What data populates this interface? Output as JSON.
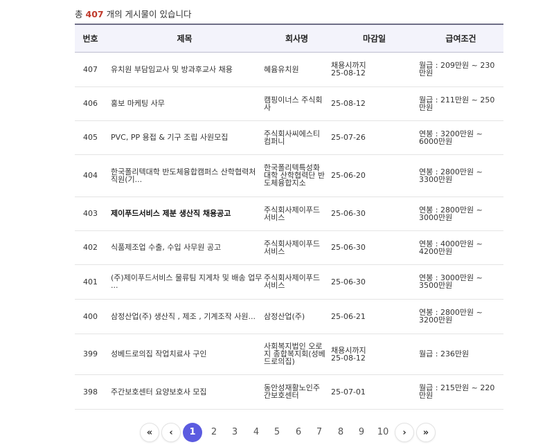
{
  "summary": {
    "prefix": "총",
    "count": "407",
    "suffix": "개의 게시물이 있습니다"
  },
  "table": {
    "headers": [
      "번호",
      "제목",
      "회사명",
      "마감일",
      "급여조건"
    ],
    "rows": [
      {
        "no": "407",
        "title": "유치원 부담임교사 및 방과후교사 채용",
        "company": "혜윰유치원",
        "deadline_lines": [
          "채용시까지",
          "25-08-12"
        ],
        "salary": "월급 : 209만원 ~ 230만원",
        "bold": false
      },
      {
        "no": "406",
        "title": "홍보 마케팅 사무",
        "company": "캠핑이너스 주식회사",
        "deadline_lines": [
          "25-08-12"
        ],
        "salary": "월급 : 211만원 ~ 250만원",
        "bold": false
      },
      {
        "no": "405",
        "title": "PVC, PP 용접 & 기구 조립 사원모집",
        "company": "주식회사씨에스티컴퍼니",
        "deadline_lines": [
          "25-07-26"
        ],
        "salary": "연봉 : 3200만원 ~ 6000만원",
        "bold": false
      },
      {
        "no": "404",
        "title": "한국폴리텍대학 반도체융합캠퍼스 산학협력처 직원(기...",
        "company": "한국폴리텍특성화대학 산학협력단 반도체융합지소",
        "deadline_lines": [
          "25-06-20"
        ],
        "salary": "연봉 : 2800만원 ~ 3300만원",
        "bold": false
      },
      {
        "no": "403",
        "title": "제이푸드서비스 제분 생산직 채용공고",
        "company": "주식회사제이푸드서비스",
        "deadline_lines": [
          "25-06-30"
        ],
        "salary": "연봉 : 2800만원 ~ 3000만원",
        "bold": true
      },
      {
        "no": "402",
        "title": "식품제조업 수출, 수입 사무원 공고",
        "company": "주식회사제이푸드서비스",
        "deadline_lines": [
          "25-06-30"
        ],
        "salary": "연봉 : 4000만원 ~ 4200만원",
        "bold": false
      },
      {
        "no": "401",
        "title": "(주)제이푸드서비스 물류팀 지게차 및 배송 업무 ...",
        "company": "주식회사제이푸드서비스",
        "deadline_lines": [
          "25-06-30"
        ],
        "salary": "연봉 : 3000만원 ~ 3500만원",
        "bold": false
      },
      {
        "no": "400",
        "title": "삼정산업(주) 생산직 , 제조 , 기계조작 사원...",
        "company": "삼정산업(주)",
        "deadline_lines": [
          "25-06-21"
        ],
        "salary": "연봉 : 2800만원 ~ 3200만원",
        "bold": false
      },
      {
        "no": "399",
        "title": "성베드로의집 작업치료사 구인",
        "company": "사회복지법인 오로지 종합복지회(성베드로의집)",
        "deadline_lines": [
          "채용시까지",
          "25-08-12"
        ],
        "salary": "월급 : 236만원",
        "bold": false
      },
      {
        "no": "398",
        "title": "주간보호센터 요양보호사 모집",
        "company": "동안성재활노인주간보호센터",
        "deadline_lines": [
          "25-07-01"
        ],
        "salary": "월급 : 215만원 ~ 220만원",
        "bold": false
      }
    ]
  },
  "pagination": {
    "first_label": "«",
    "prev_label": "‹",
    "pages": [
      "1",
      "2",
      "3",
      "4",
      "5",
      "6",
      "7",
      "8",
      "9",
      "10"
    ],
    "current": "1",
    "next_label": "›",
    "last_label": "»"
  }
}
